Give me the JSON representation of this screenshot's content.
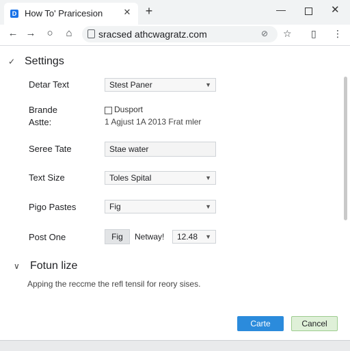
{
  "browser": {
    "tab_title": "How To' Praricesion",
    "favicon_letter": "D",
    "tab_close_icon": "✕",
    "new_tab_icon": "+",
    "url": "sracsed athcwagratz.com"
  },
  "settings": {
    "section_title": "Settings",
    "rows": {
      "default_text": {
        "label": "Detar Text",
        "value": "Stest Paner"
      },
      "brande": {
        "label": "Brande",
        "checkbox_label": "Dusport",
        "checked": false
      },
      "astte": {
        "label": "Astte:",
        "value": "1 Agjust 1A 2013 Frat mler"
      },
      "seree_tate": {
        "label": "Seree Tate",
        "value": "Stae water"
      },
      "text_size": {
        "label": "Text Size",
        "value": "Toles Spital"
      },
      "pigo_pastes": {
        "label": "Pigo Pastes",
        "value": "Fig"
      },
      "post_one": {
        "label": "Post One",
        "button": "Fig",
        "extra_label": "Netway!",
        "value": "12.48"
      }
    }
  },
  "fotun": {
    "section_title": "Fotun lize",
    "description": "Apping the reccme the refl tensil for reory sises."
  },
  "actions": {
    "primary": "Carte",
    "secondary": "Cancel"
  },
  "colors": {
    "primary_button": "#2b8bdc",
    "secondary_button": "#dff0d8"
  }
}
